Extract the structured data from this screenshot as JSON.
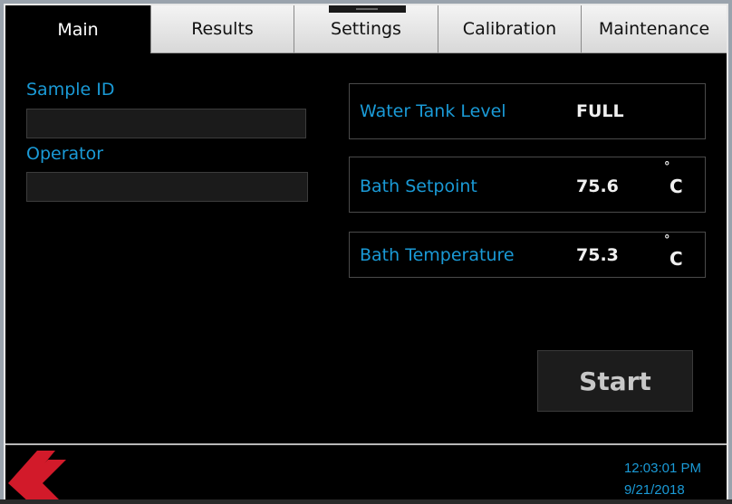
{
  "tabs": [
    {
      "label": "Main",
      "active": true
    },
    {
      "label": "Results",
      "active": false
    },
    {
      "label": "Settings",
      "active": false
    },
    {
      "label": "Calibration",
      "active": false
    },
    {
      "label": "Maintenance",
      "active": false
    }
  ],
  "form": {
    "sample_id_label": "Sample ID",
    "sample_id_value": "",
    "operator_label": "Operator",
    "operator_value": ""
  },
  "status": {
    "water_tank": {
      "label": "Water Tank Level",
      "value": "FULL"
    },
    "bath_setpoint": {
      "label": "Bath Setpoint",
      "value": "75.6",
      "unit_degree": "°",
      "unit_letter": "C"
    },
    "bath_temperature": {
      "label": "Bath Temperature",
      "value": "75.3",
      "unit_degree": "°",
      "unit_letter": "C"
    }
  },
  "actions": {
    "start_label": "Start"
  },
  "footer": {
    "logo_icon": "double-chevron-left-logo",
    "time": "12:03:01 PM",
    "date": "9/21/2018"
  },
  "colors": {
    "accent": "#1a9ad6",
    "logo_red": "#d21a2a",
    "background": "#000000"
  }
}
